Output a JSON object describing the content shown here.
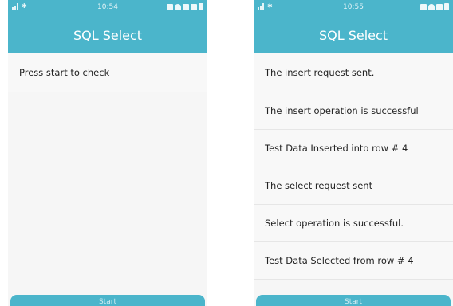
{
  "left": {
    "status": {
      "time": "10:54"
    },
    "title": "SQL Select",
    "rows": [
      "Press start to check"
    ],
    "start_label": "Start"
  },
  "right": {
    "status": {
      "time": "10:55"
    },
    "title": "SQL Select",
    "rows": [
      "The insert request sent.",
      "The insert operation is successful",
      "Test Data Inserted into row # 4",
      "The select request sent",
      "Select operation is successful.",
      "Test Data Selected from row # 4"
    ],
    "start_label": "Start"
  },
  "colors": {
    "accent": "#4bb5cb",
    "list_bg": "#f6f6f6",
    "divider": "#e6e6e6",
    "text": "#222222"
  },
  "icons": {
    "status_left": [
      "signal-icon",
      "bluetooth-icon"
    ],
    "status_right": [
      "nfc-icon",
      "wifi-icon",
      "sound-icon",
      "sim-icon",
      "battery-icon"
    ]
  }
}
